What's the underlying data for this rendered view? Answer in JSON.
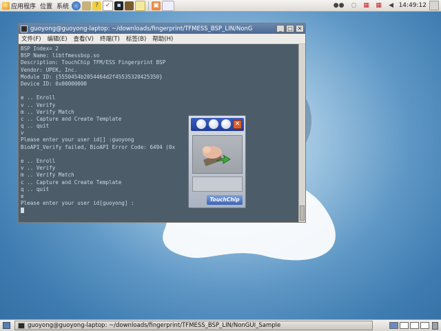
{
  "top_panel": {
    "menus": [
      "应用程序",
      "位置",
      "系统"
    ],
    "launchers": [
      "web-browser-icon",
      "email-icon",
      "help-icon",
      "text-editor-icon",
      "terminal-icon",
      "dictionary-icon",
      "notes-icon",
      "image-viewer-icon"
    ],
    "clock": "14:49:12"
  },
  "terminal": {
    "title": "guoyong@guoyong-laptop: ~/downloads/fingerprint/TFMESS_BSP_LIN/NonG",
    "menu": [
      "文件(F)",
      "编辑(E)",
      "查看(V)",
      "终端(T)",
      "标签(B)",
      "帮助(H)"
    ],
    "lines": [
      "BSP Index= 2",
      "BSP Name: libtfmessbsp.so",
      "Description: TouchChip TFM/ESS Fingerprint BSP",
      "Vendor: UPEK, Inc.",
      "Module ID: {5550454b2054464d2f45535320425350}",
      "Device ID: 0x00000000",
      "",
      "e .. Enroll",
      "v .. Verify",
      "m .. Verify Match",
      "c .. Capture and Create Template",
      "q .. quit",
      "v",
      "Please enter your user id[] :guoyong",
      "BioAPI_Verify failed, BioAPI Error Code: 6494 (0x",
      "",
      "e .. Enroll",
      "v .. Verify",
      "m .. Verify Match",
      "c .. Capture and Create Template",
      "q .. quit",
      "e",
      "Please enter your user id[guoyong] :",
      ""
    ]
  },
  "touchchip": {
    "logo": "TouchChip",
    "close": "✕"
  },
  "bottom_panel": {
    "task_title": "guoyong@guoyong-laptop: ~/downloads/fingerprint/TFMESS_BSP_LIN/NonGUI_Sample"
  }
}
